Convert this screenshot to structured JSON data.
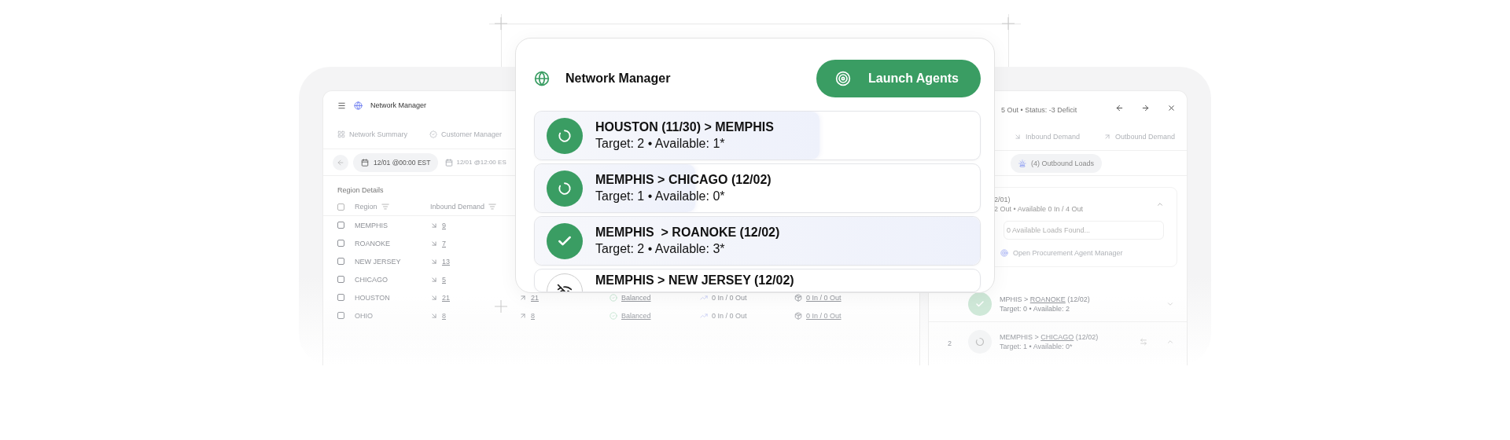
{
  "left_panel": {
    "title": "Network Manager",
    "tabs": [
      {
        "label": "Network Summary",
        "kind": "grid"
      },
      {
        "label": "Customer Manager",
        "kind": "badge"
      }
    ],
    "dates": [
      {
        "label": "12/01 @00:00 EST",
        "selected": true
      },
      {
        "label": "12/01 @12:00 ES",
        "selected": false
      }
    ],
    "section_title": "Region Details",
    "table": {
      "all_checked": false,
      "columns": [
        "Region",
        "Inbound Demand"
      ],
      "rows": [
        {
          "checked": false,
          "region": "MEMPHIS",
          "inbound": "9"
        },
        {
          "checked": false,
          "region": "ROANOKE",
          "inbound": "7"
        },
        {
          "checked": false,
          "region": "NEW JERSEY",
          "inbound": "13"
        },
        {
          "checked": false,
          "region": "CHICAGO",
          "inbound": "5"
        },
        {
          "checked": false,
          "region": "HOUSTON",
          "inbound": "21",
          "outbound": "21",
          "status": "Balanced",
          "trend": "0 In / 0 Out",
          "loads": "0 In / 0 Out"
        },
        {
          "checked": false,
          "region": "OHIO",
          "inbound": "8",
          "outbound": "8",
          "status": "Balanced",
          "trend": "0 In / 0 Out",
          "loads": "0 In / 0 Out"
        }
      ]
    }
  },
  "right_panel": {
    "header": "5 Out • Status: -3 Deficit",
    "tabs": [
      {
        "label": "Inbound Demand",
        "kind": "inbound"
      },
      {
        "label": "Outbound Demand",
        "kind": "outbound"
      }
    ],
    "chip": "(4) Outbound Loads",
    "open_section": {
      "title": "2/01)",
      "subtitle": "2 Out • Available 0 In / 4 Out",
      "expanded": true,
      "field_placeholder": "0 Available Loads Found...",
      "link": "Open Procurement Agent Manager"
    },
    "rows": [
      {
        "title_start": "MPHIS > ",
        "title_link": "ROANOKE",
        "title_end": " (12/02)",
        "subtitle": "Target: 0 • Available: 2",
        "kind": "done",
        "expanded": false
      },
      {
        "index": "2",
        "title_start": "MEMPHIS > ",
        "title_link": "CHICAGO",
        "title_end": " (12/02)",
        "subtitle": "Target: 1 • Available: 0*",
        "kind": "running",
        "expanded": true
      }
    ]
  },
  "card": {
    "title": "Network Manager",
    "button": "Launch Agents",
    "items": [
      {
        "title": "HOUSTON (11/30) > MEMPHIS",
        "subtitle": "Target: 2 • Available: 1*",
        "kind": "running",
        "level": 0.64
      },
      {
        "title": "MEMPHIS > CHICAGO (12/02)",
        "subtitle": "Target: 1 • Available: 0*",
        "kind": "running",
        "level": 0.36
      },
      {
        "title": "MEMPHIS  > ROANOKE (12/02)",
        "subtitle": "Target: 2 • Available: 3*",
        "kind": "done",
        "level": 1
      },
      {
        "title": "MEMPHIS > NEW JERSEY (12/02)",
        "kind": "offline",
        "level": 0
      }
    ]
  }
}
